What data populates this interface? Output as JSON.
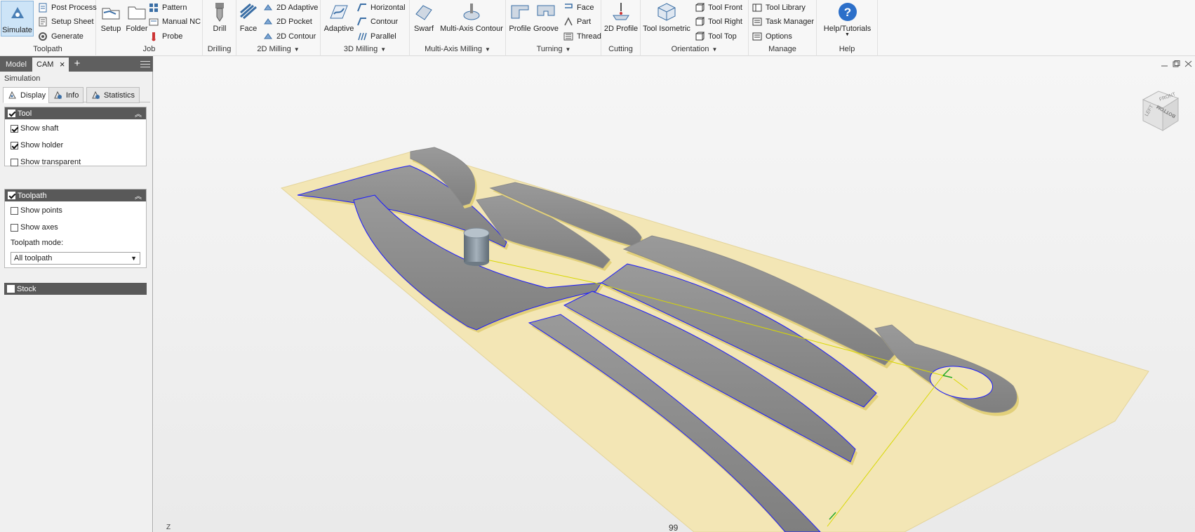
{
  "ribbon": {
    "groups": {
      "toolpath": {
        "title": "Toolpath",
        "simulate": "Simulate",
        "post_process": "Post Process",
        "setup_sheet": "Setup Sheet",
        "generate": "Generate"
      },
      "job": {
        "title": "Job",
        "setup": "Setup",
        "folder": "Folder",
        "pattern": "Pattern",
        "manual_nc": "Manual NC",
        "probe": "Probe"
      },
      "drilling": {
        "title": "Drilling",
        "drill": "Drill"
      },
      "milling_2d": {
        "title": "2D Milling",
        "face": "Face",
        "adaptive_2d": "2D Adaptive",
        "pocket_2d": "2D Pocket",
        "contour_2d": "2D Contour"
      },
      "milling_3d": {
        "title": "3D Milling",
        "adaptive": "Adaptive",
        "horizontal": "Horizontal",
        "contour": "Contour",
        "parallel": "Parallel"
      },
      "multi_axis": {
        "title": "Multi-Axis Milling",
        "swarf": "Swarf",
        "multi_axis_contour": "Multi-Axis Contour"
      },
      "turning": {
        "title": "Turning",
        "profile": "Profile",
        "groove": "Groove",
        "face": "Face",
        "part": "Part",
        "thread": "Thread"
      },
      "cutting": {
        "title": "Cutting",
        "profile_2d": "2D Profile"
      },
      "orientation": {
        "title": "Orientation",
        "tool_isometric": "Tool Isometric",
        "tool_front": "Tool Front",
        "tool_right": "Tool Right",
        "tool_top": "Tool Top"
      },
      "manage": {
        "title": "Manage",
        "tool_library": "Tool Library",
        "task_manager": "Task Manager",
        "options": "Options"
      },
      "help": {
        "title": "Help",
        "help_tutorials": "Help/Tutorials"
      }
    }
  },
  "panel": {
    "tabs": {
      "model": "Model",
      "cam": "CAM",
      "add": "+"
    },
    "title": "Simulation",
    "sim_tabs": {
      "display": "Display",
      "info": "Info",
      "statistics": "Statistics"
    },
    "tool_section": {
      "title": "Tool",
      "checked": true,
      "show_shaft": "Show shaft",
      "show_shaft_checked": true,
      "show_holder": "Show holder",
      "show_holder_checked": true,
      "show_transparent": "Show transparent",
      "show_transparent_checked": false
    },
    "toolpath_section": {
      "title": "Toolpath",
      "checked": true,
      "show_points": "Show points",
      "show_axes": "Show axes",
      "mode_label": "Toolpath mode:",
      "mode_value": "All toolpath"
    },
    "stock_section": {
      "title": "Stock",
      "checked": false
    }
  },
  "viewport": {
    "view_cube": {
      "faces": [
        "FRONT",
        "LEFT",
        "BOTTOM"
      ]
    },
    "axis_label": "Z",
    "bottom_text": "99"
  },
  "colors": {
    "ribbon_bg": "#f7f7f7",
    "panel_header": "#595959",
    "stock_plate": "#f3e6b5",
    "part_gray": "#8f8f8f",
    "contour_blue": "#1a1aff",
    "rapid_yellow": "#e6e600",
    "tool": "#7d8a95"
  }
}
